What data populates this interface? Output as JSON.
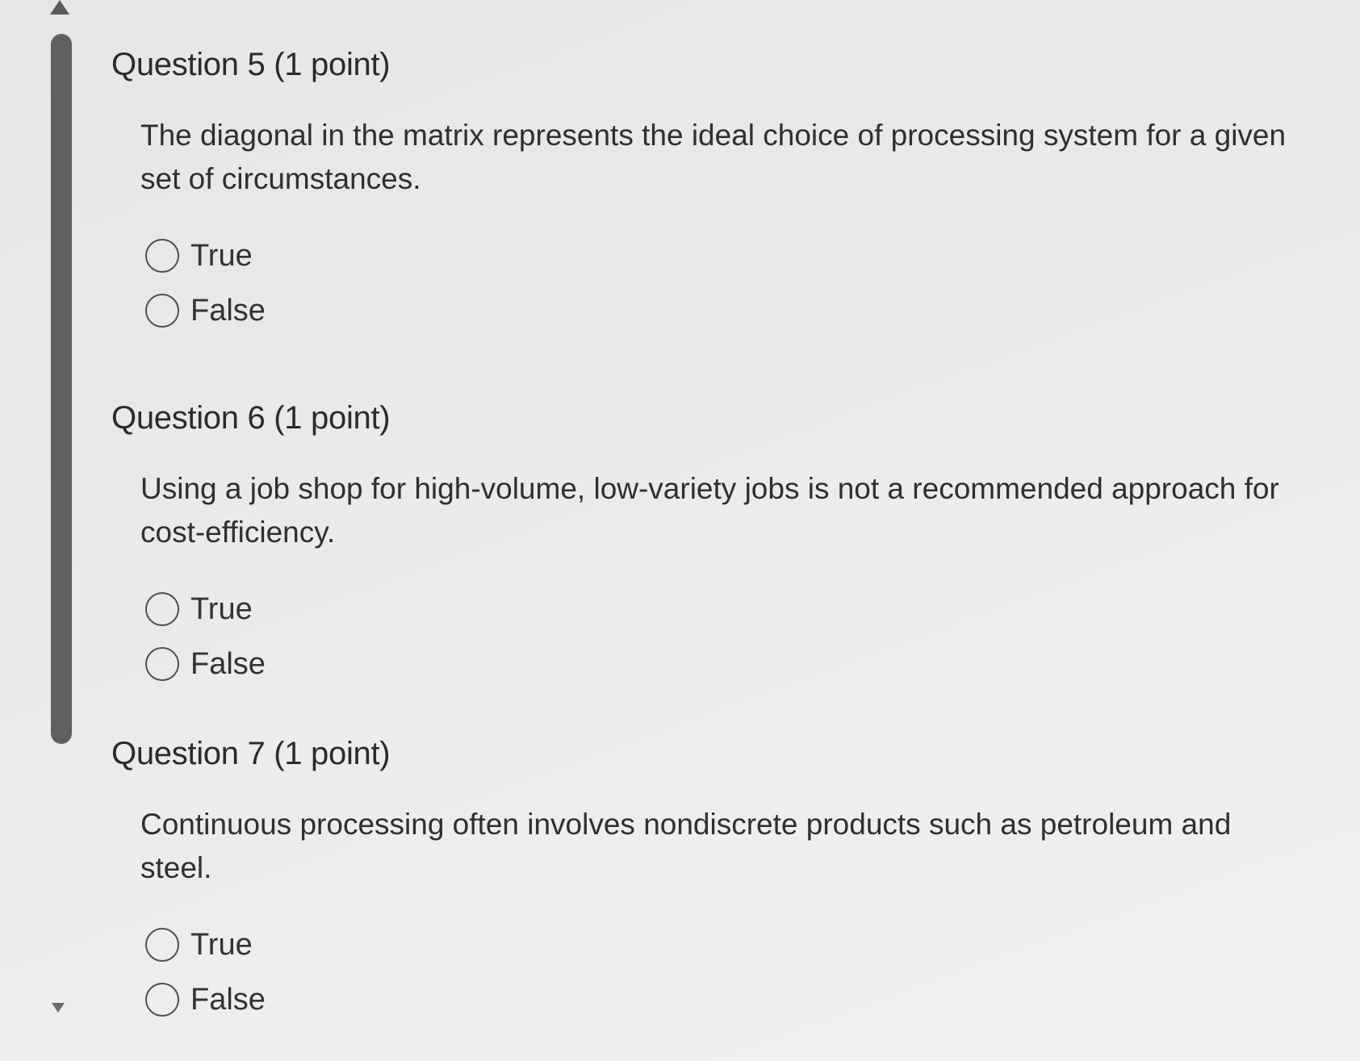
{
  "questions": [
    {
      "title": "Question 5 (1 point)",
      "text": "The diagonal in the matrix represents the ideal choice of processing system for a given set of circumstances.",
      "options": [
        "True",
        "False"
      ]
    },
    {
      "title": "Question 6 (1 point)",
      "text": "Using a job shop for high-volume, low-variety jobs is not a recommended approach for cost-efficiency.",
      "options": [
        "True",
        "False"
      ]
    },
    {
      "title": "Question 7 (1 point)",
      "text": "Continuous processing often involves nondiscrete products such as petroleum and steel.",
      "options": [
        "True",
        "False"
      ]
    }
  ],
  "colors": {
    "background": "#e9e9e9",
    "scrollbar": "#5f5f5f",
    "text": "#2b2b2b"
  }
}
